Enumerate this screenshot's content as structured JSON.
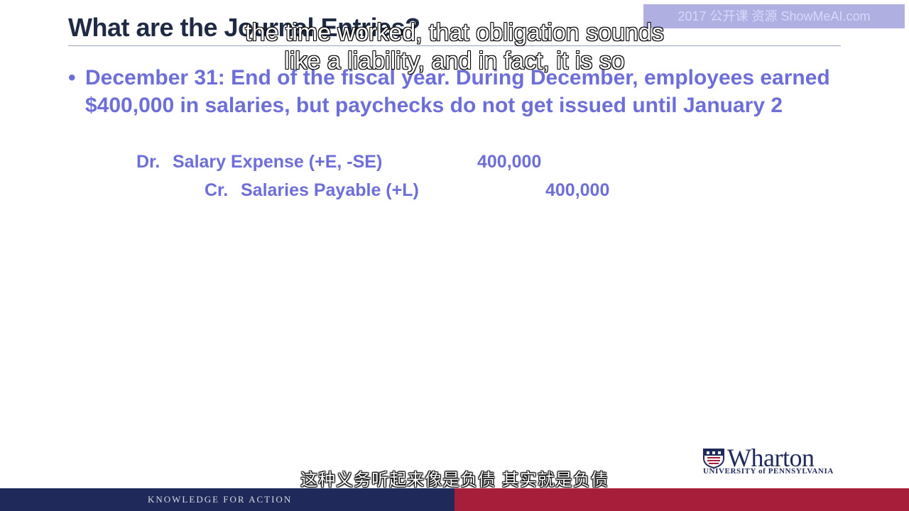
{
  "slide": {
    "title": "What are the Journal Entries?",
    "bullet_symbol": "•",
    "bullet_text": "December 31: End of the fiscal year.  During December, employees earned $400,000 in salaries, but paychecks do not get issued until January 2",
    "debit": {
      "label": "Dr.",
      "account": "Salary Expense (+E, -SE)",
      "amount": "400,000"
    },
    "credit": {
      "label": "Cr.",
      "account": "Salaries Payable (+L)",
      "amount": "400,000"
    }
  },
  "subtitles": {
    "english_line1": "the time worked, that obligation sounds",
    "english_line2": "like a liability, and in fact, it is so",
    "chinese": "这种义务听起来像是负债 其实就是负债"
  },
  "watermark": {
    "text": "2017 公开课 资源 ShowMeAI.com"
  },
  "logo": {
    "name": "Wharton",
    "university": "UNIVERSITY of PENNSYLVANIA"
  },
  "footer": {
    "tagline": "KNOWLEDGE FOR ACTION"
  },
  "colors": {
    "navy": "#1f2a5a",
    "crimson": "#a61e3a",
    "body_text": "#6e6ed8",
    "title_text": "#1f2a44"
  }
}
